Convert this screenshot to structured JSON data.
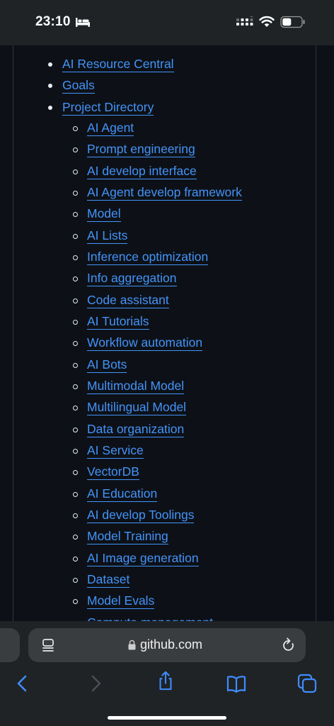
{
  "status_bar": {
    "time": "23:10"
  },
  "toc": {
    "items": [
      {
        "label": "AI Resource Central"
      },
      {
        "label": "Goals"
      },
      {
        "label": "Project Directory"
      }
    ],
    "sub_items": [
      {
        "label": "AI Agent"
      },
      {
        "label": "Prompt engineering"
      },
      {
        "label": "AI develop interface"
      },
      {
        "label": "AI Agent develop framework"
      },
      {
        "label": "Model"
      },
      {
        "label": "AI Lists"
      },
      {
        "label": "Inference optimization"
      },
      {
        "label": "Info aggregation"
      },
      {
        "label": "Code assistant"
      },
      {
        "label": "AI Tutorials"
      },
      {
        "label": "Workflow automation"
      },
      {
        "label": "AI Bots"
      },
      {
        "label": "Multimodal Model"
      },
      {
        "label": "Multilingual Model"
      },
      {
        "label": "Data organization"
      },
      {
        "label": "AI Service"
      },
      {
        "label": "VectorDB"
      },
      {
        "label": "AI Education"
      },
      {
        "label": "AI develop Toolings"
      },
      {
        "label": "Model Training"
      },
      {
        "label": "AI Image generation"
      },
      {
        "label": "Dataset"
      },
      {
        "label": "Model Evals"
      },
      {
        "label": "Compute management"
      }
    ]
  },
  "browser": {
    "url": "github.com"
  },
  "colors": {
    "link": "#4493f8",
    "page_bg": "#0d1117",
    "chrome_bg": "#1f2326",
    "toolbar_icon": "#3f8cff"
  },
  "icons": [
    "bed-icon",
    "signal-icon",
    "wifi-icon",
    "battery-icon",
    "page-menu-icon",
    "lock-icon",
    "reload-icon",
    "back-icon",
    "forward-icon",
    "share-icon",
    "bookmarks-icon",
    "tabs-icon"
  ]
}
